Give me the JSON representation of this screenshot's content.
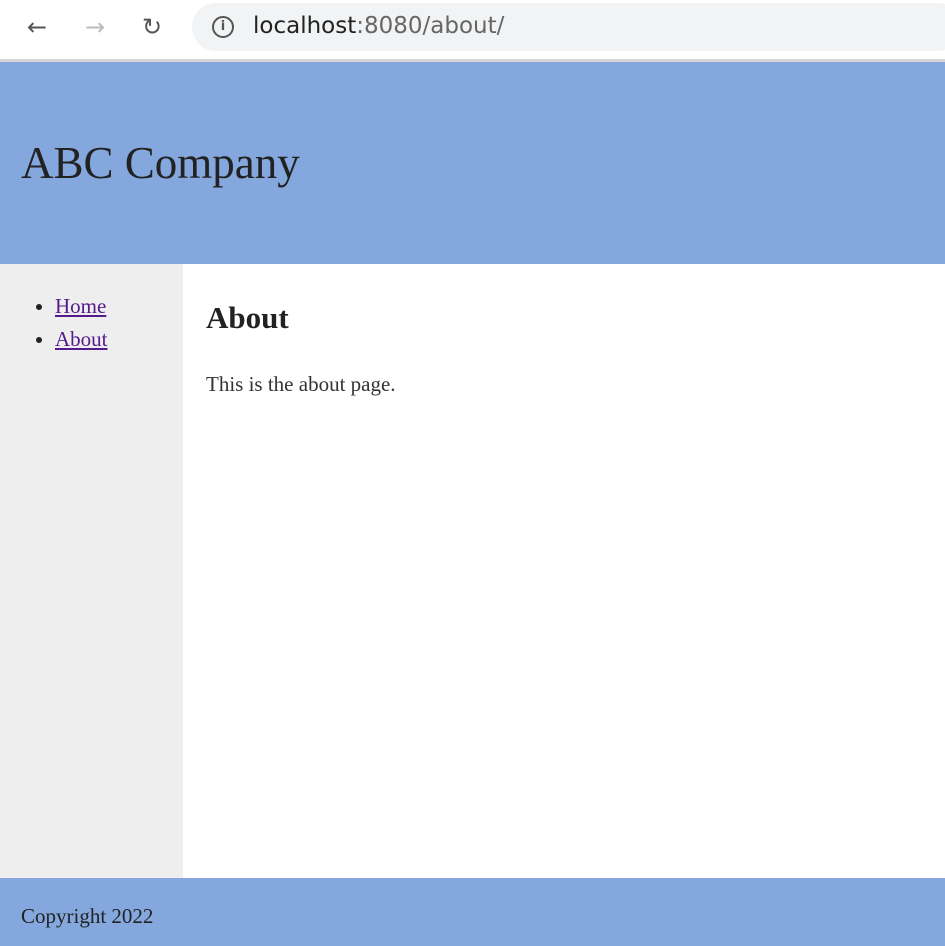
{
  "browser": {
    "url_host": "localhost",
    "url_rest": ":8080/about/"
  },
  "header": {
    "title": "ABC Company"
  },
  "sidebar": {
    "items": [
      {
        "label": "Home"
      },
      {
        "label": "About"
      }
    ]
  },
  "main": {
    "heading": "About",
    "body": "This is the about page."
  },
  "footer": {
    "text": "Copyright 2022"
  },
  "colors": {
    "header_bg": "#84a8dd",
    "sidebar_bg": "#eeeeee",
    "link": "#551a8b"
  }
}
